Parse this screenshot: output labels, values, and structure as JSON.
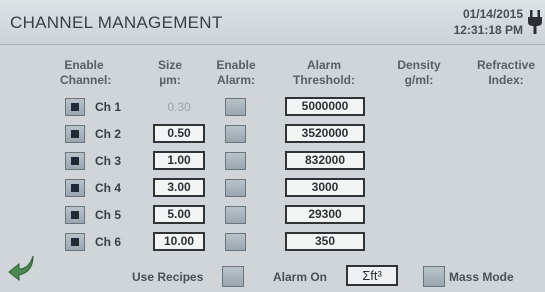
{
  "header": {
    "title": "CHANNEL MANAGEMENT",
    "date": "01/14/2015",
    "time": "12:31:18 PM"
  },
  "columns": {
    "enable_channel": "Enable\nChannel:",
    "size": "Size\nµm:",
    "enable_alarm": "Enable\nAlarm:",
    "alarm_threshold": "Alarm\nThreshold:",
    "density": "Density\ng/ml:",
    "refractive": "Refractive\nIndex:"
  },
  "channels": [
    {
      "label": "Ch 1",
      "size": "0.30",
      "threshold": "5000000"
    },
    {
      "label": "Ch 2",
      "size": "0.50",
      "threshold": "3520000"
    },
    {
      "label": "Ch 3",
      "size": "1.00",
      "threshold": "832000"
    },
    {
      "label": "Ch 4",
      "size": "3.00",
      "threshold": "3000"
    },
    {
      "label": "Ch 5",
      "size": "5.00",
      "threshold": "29300"
    },
    {
      "label": "Ch 6",
      "size": "10.00",
      "threshold": "350"
    }
  ],
  "footer": {
    "use_recipes": "Use Recipes",
    "alarm_on": "Alarm On",
    "alarm_unit": "Σft³",
    "mass_mode": "Mass Mode"
  },
  "icons": {
    "back": "back-arrow-icon",
    "power": "power-plug-icon"
  },
  "colors": {
    "background": "#cfd5d8",
    "checkbox": "#a6b1b9",
    "back_arrow": "#4d8a4f"
  }
}
